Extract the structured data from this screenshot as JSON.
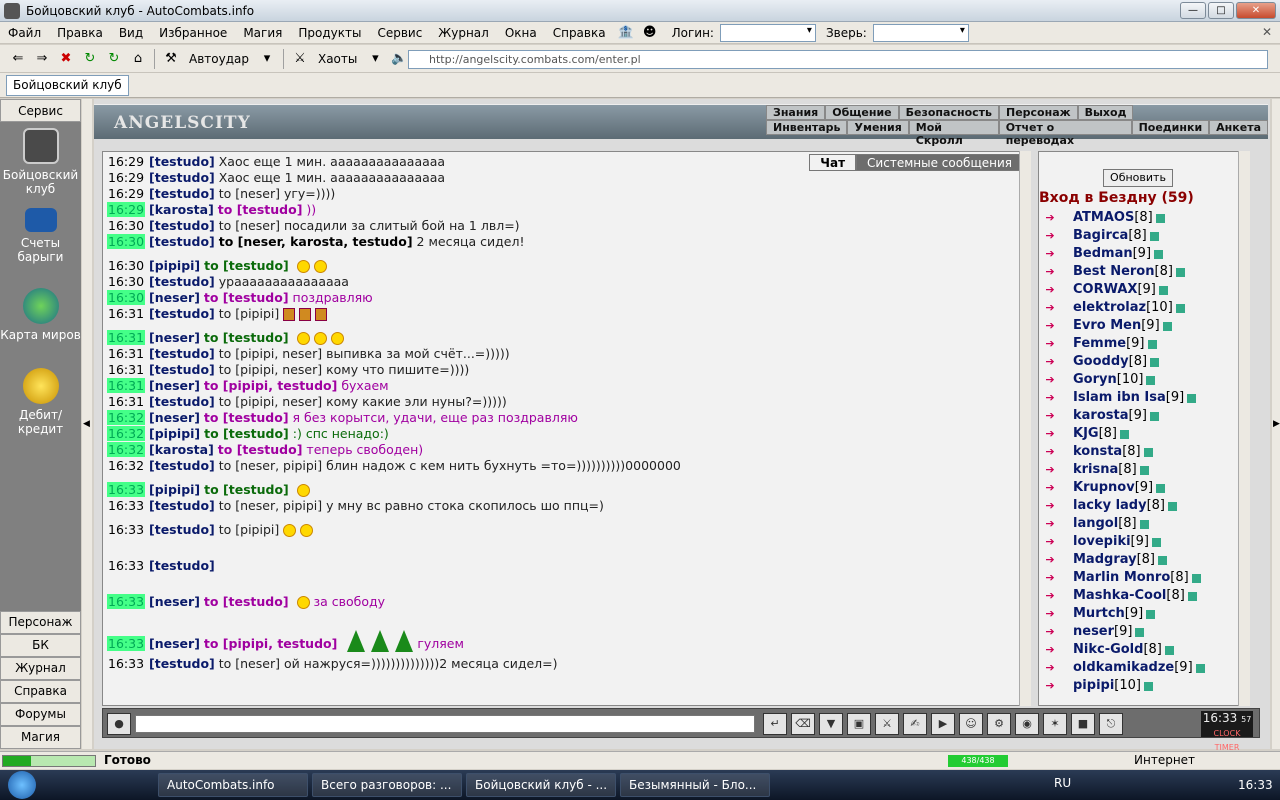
{
  "window": {
    "title": "Бойцовский клуб - AutoCombats.info"
  },
  "menu": {
    "items": [
      "Файл",
      "Правка",
      "Вид",
      "Избранное",
      "Магия",
      "Продукты",
      "Сервис",
      "Журнал",
      "Окна",
      "Справка"
    ],
    "login_label": "Логин:",
    "beast_label": "Зверь:"
  },
  "toolbar": {
    "autostrike": "Автоудар",
    "chaos": "Хаоты",
    "url": "http://angelscity.combats.com/enter.pl"
  },
  "tab": {
    "label": "Бойцовский клуб"
  },
  "sidebar": {
    "header": "Сервис",
    "items": [
      {
        "label": "Бойцовский клуб",
        "icon": "fight-club-icon"
      },
      {
        "label": "Счеты барыги",
        "icon": "abacus-icon"
      },
      {
        "label": "Карта миров",
        "icon": "globe-map-icon"
      },
      {
        "label": "Дебит/кредит",
        "icon": "coins-icon"
      }
    ],
    "bottom": [
      "Персонаж",
      "БК",
      "Журнал",
      "Справка",
      "Форумы",
      "Магия"
    ]
  },
  "banner": {
    "logo": "ANGELSCITY",
    "nav_top": [
      "Знания",
      "Общение",
      "Безопасность",
      "Персонаж",
      "Выход"
    ],
    "nav_bottom": [
      "Инвентарь",
      "Умения",
      "Мой Скролл",
      "Отчет о переводах",
      "Поединки",
      "Анкета"
    ]
  },
  "chat": {
    "tabs": [
      "Чат",
      "Системные сообщения"
    ],
    "lines": [
      {
        "time": "16:29",
        "name": "[testudo]",
        "to": "",
        "msg": "Хаос еще 1 мин. ааааааааааааааа",
        "hl": false,
        "priv": false
      },
      {
        "time": "16:29",
        "name": "[testudo]",
        "to": "",
        "msg": "Хаос еще 1 мин. ааааааааааааааа",
        "hl": false,
        "priv": false
      },
      {
        "time": "16:29",
        "name": "[testudo]",
        "to": "",
        "msg": "to [neser] угу=))))",
        "hl": false,
        "priv": false
      },
      {
        "time": "16:29",
        "name": "[karosta]",
        "to": "to [testudo]",
        "msg": "))",
        "hl": true,
        "priv": true
      },
      {
        "time": "16:30",
        "name": "[testudo]",
        "to": "",
        "msg": "to [neser] посадили за слитый бой на 1 лвл=)",
        "hl": false,
        "priv": false
      },
      {
        "time": "16:30",
        "name": "[testudo]",
        "to": "to [neser, karosta, testudo]",
        "msg": "2 месяца сидел!",
        "hl": true,
        "priv": false,
        "toBlack": true
      },
      {
        "gap": true
      },
      {
        "time": "16:30",
        "name": "[pipipi]",
        "to": "to [testudo]",
        "msg": "",
        "hl": false,
        "priv": false,
        "smiles": 2
      },
      {
        "time": "16:30",
        "name": "[testudo]",
        "to": "",
        "msg": "урааааааааааааааа",
        "hl": false,
        "priv": false
      },
      {
        "time": "16:30",
        "name": "[neser]",
        "to": "to [testudo]",
        "msg": "поздравляю",
        "hl": true,
        "priv": true
      },
      {
        "time": "16:31",
        "name": "[testudo]",
        "to": "",
        "msg": "to [pipipi]",
        "hl": false,
        "priv": false,
        "beers": 3
      },
      {
        "gap": true
      },
      {
        "time": "16:31",
        "name": "[neser]",
        "to": "to [testudo]",
        "msg": "",
        "hl": true,
        "priv": false,
        "smiles": 3
      },
      {
        "time": "16:31",
        "name": "[testudo]",
        "to": "",
        "msg": "to [pipipi, neser] выпивка за мой счёт...=)))))",
        "hl": false,
        "priv": false
      },
      {
        "time": "16:31",
        "name": "[testudo]",
        "to": "",
        "msg": "to [pipipi, neser] кому что пишите=))))",
        "hl": false,
        "priv": false
      },
      {
        "time": "16:31",
        "name": "[neser]",
        "to": "to [pipipi, testudo]",
        "msg": "бухаем",
        "hl": true,
        "priv": true
      },
      {
        "time": "16:31",
        "name": "[testudo]",
        "to": "",
        "msg": "to [pipipi, neser] кому какие эли нуны?=)))))",
        "hl": false,
        "priv": false
      },
      {
        "time": "16:32",
        "name": "[neser]",
        "to": "to [testudo]",
        "msg": "я без корытси, удачи, еще раз поздравляю",
        "hl": true,
        "priv": true
      },
      {
        "time": "16:32",
        "name": "[pipipi]",
        "to": "to [testudo]",
        "msg": ":) спс ненадо:)",
        "hl": true,
        "priv": false,
        "green": true
      },
      {
        "time": "16:32",
        "name": "[karosta]",
        "to": "to [testudo]",
        "msg": "теперь свободен)",
        "hl": true,
        "priv": true
      },
      {
        "time": "16:32",
        "name": "[testudo]",
        "to": "",
        "msg": "to [neser, pipipi] блин надож с кем нить бухнуть =то=))))))))))0000000",
        "hl": false,
        "priv": false
      },
      {
        "gap": true
      },
      {
        "time": "16:33",
        "name": "[pipipi]",
        "to": "to [testudo]",
        "msg": "",
        "hl": true,
        "priv": false,
        "smiles": 1
      },
      {
        "time": "16:33",
        "name": "[testudo]",
        "to": "",
        "msg": "to [neser, pipipi] у мну вс равно стока скопилось шо ппц=)",
        "hl": false,
        "priv": false
      },
      {
        "gap": true
      },
      {
        "time": "16:33",
        "name": "[testudo]",
        "to": "",
        "msg": "to [pipipi]",
        "hl": false,
        "priv": false,
        "smiles": 2
      },
      {
        "gap": true,
        "big": true
      },
      {
        "time": "16:33",
        "name": "[testudo]",
        "to": "",
        "msg": "",
        "hl": false,
        "priv": false
      },
      {
        "gap": true,
        "big": true
      },
      {
        "time": "16:33",
        "name": "[neser]",
        "to": "to [testudo]",
        "msg": "за свободу",
        "hl": true,
        "priv": true,
        "smiles": 1
      },
      {
        "gap": true,
        "big": true
      },
      {
        "time": "16:33",
        "name": "[neser]",
        "to": "to [pipipi, testudo]",
        "msg": "гуляем",
        "hl": true,
        "priv": true,
        "trees": 3
      },
      {
        "time": "16:33",
        "name": "[testudo]",
        "to": "",
        "msg": "to [neser] ой нажруся=))))))))))))))2 месяца сидел=)",
        "hl": false,
        "priv": false
      }
    ]
  },
  "userlist": {
    "refresh": "Обновить",
    "title": "Вход в Бездну (59)",
    "users": [
      {
        "name": "ATMAOS",
        "level": "[8]"
      },
      {
        "name": "Bagirca",
        "level": "[8]"
      },
      {
        "name": "Bedman",
        "level": "[9]"
      },
      {
        "name": "Best Neron",
        "level": "[8]"
      },
      {
        "name": "CORWAX",
        "level": "[9]"
      },
      {
        "name": "elektrolaz",
        "level": "[10]"
      },
      {
        "name": "Evro Men",
        "level": "[9]"
      },
      {
        "name": "Femme",
        "level": "[9]"
      },
      {
        "name": "Gooddy",
        "level": "[8]"
      },
      {
        "name": "Goryn",
        "level": "[10]"
      },
      {
        "name": "Islam ibn Isa",
        "level": "[9]"
      },
      {
        "name": "karosta",
        "level": "[9]"
      },
      {
        "name": "KJG",
        "level": "[8]"
      },
      {
        "name": "konsta",
        "level": "[8]"
      },
      {
        "name": "krisna",
        "level": "[8]"
      },
      {
        "name": "Krupnov",
        "level": "[9]"
      },
      {
        "name": "lacky lady",
        "level": "[8]"
      },
      {
        "name": "langol",
        "level": "[8]"
      },
      {
        "name": "lovepiki",
        "level": "[9]"
      },
      {
        "name": "Madgray",
        "level": "[8]"
      },
      {
        "name": "Marlin Monro",
        "level": "[8]"
      },
      {
        "name": "Mashka-Cool",
        "level": "[8]"
      },
      {
        "name": "Murtch",
        "level": "[9]"
      },
      {
        "name": "neser",
        "level": "[9]"
      },
      {
        "name": "Nikc-Gold",
        "level": "[8]"
      },
      {
        "name": "oldkamikadze",
        "level": "[9]"
      },
      {
        "name": "pipipi",
        "level": "[10]"
      }
    ]
  },
  "clock": {
    "time": "16:33",
    "seconds": "57",
    "label": "CLOCK  TIMER"
  },
  "status": {
    "text": "Готово",
    "hp": "438/438",
    "zone": "Интернет"
  },
  "taskbar": {
    "tasks": [
      "AutoCombats.info",
      "Всего разговоров: ...",
      "Бойцовский клуб - ...",
      "Безымянный - Бло..."
    ],
    "lang": "RU",
    "time": "16:33"
  }
}
